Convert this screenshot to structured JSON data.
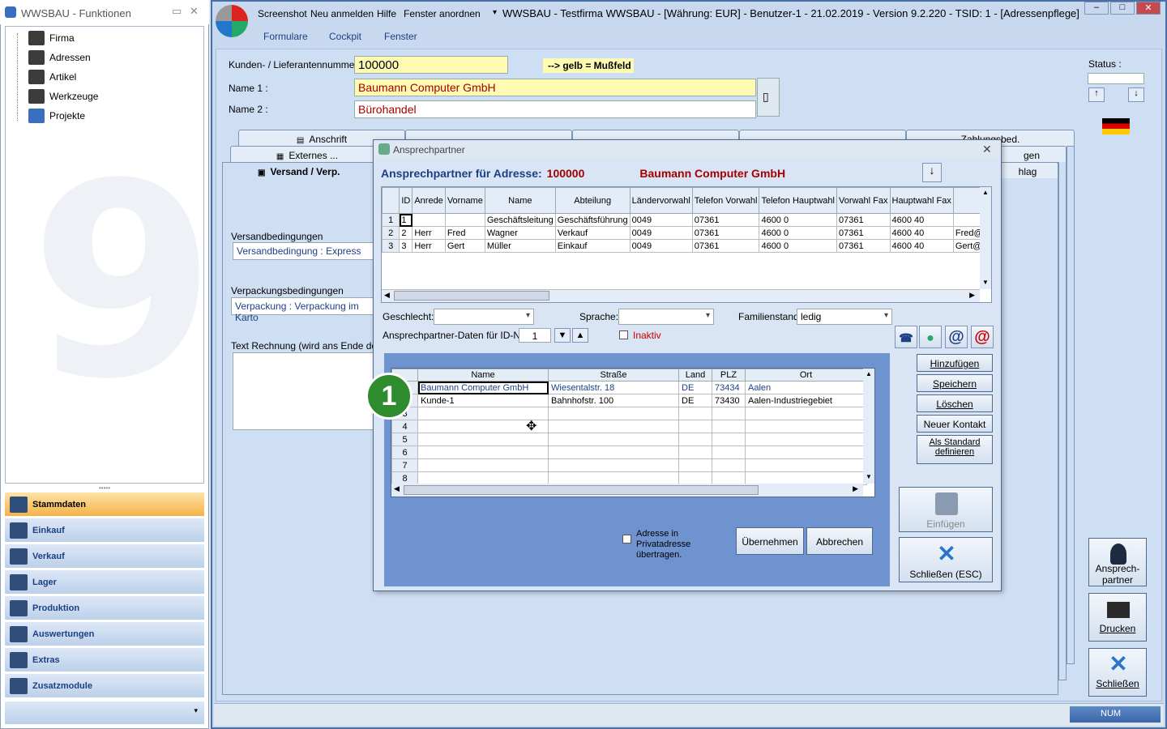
{
  "left_panel": {
    "title": "WWSBAU - Funktionen",
    "tree": [
      "Firma",
      "Adressen",
      "Artikel",
      "Werkzeuge",
      "Projekte"
    ],
    "nav": [
      "Stammdaten",
      "Einkauf",
      "Verkauf",
      "Lager",
      "Produktion",
      "Auswertungen",
      "Extras",
      "Zusatzmodule"
    ],
    "active_nav": "Stammdaten"
  },
  "titlebar": {
    "menus": [
      "Screenshot",
      "Neu anmelden",
      "Hilfe",
      "Fenster anordnen"
    ],
    "title": "WWSBAU - Testfirma WWSBAU - [Währung: EUR] - Benutzer-1 - 21.02.2019 - Version 9.2.220 - TSID: 1 - [Adressenpflege]"
  },
  "menubar": [
    "Formulare",
    "Cockpit",
    "Fenster"
  ],
  "header": {
    "kundennr_label": "Kunden- / Lieferantennummer :",
    "kundennr": "100000",
    "mussfeld": "--> gelb = Mußfeld",
    "name1_label": "Name 1 :",
    "name1": "Baumann Computer GmbH",
    "name2_label": "Name 2 :",
    "name2": "Bürohandel"
  },
  "tabs": {
    "row1": [
      "Anschrift",
      "",
      "",
      "",
      "Zahlungsbed."
    ],
    "row2": [
      "Externes ...",
      "gen"
    ],
    "row3": [
      "Versand / Verp.",
      "hlag"
    ]
  },
  "back_form": {
    "versand_label": "Versandbedingungen",
    "versand_value": "Versandbedingung : Express",
    "verpackung_label": "Verpackungsbedingungen",
    "verpackung_value": "Verpackung :  Verpackung im Karto",
    "text_label": "Text Rechnung (wird ans Ende des F"
  },
  "right_side": {
    "status_label": "Status :",
    "btn_ansprech": "Ansprech-partner",
    "btn_drucken": "Drucken",
    "btn_schliessen": "Schließen"
  },
  "statusbar": {
    "num": "NUM"
  },
  "dialog": {
    "title": "Ansprechpartner",
    "head_label": "Ansprechpartner für Adresse:",
    "head_number": "100000",
    "head_company": "Baumann Computer GmbH",
    "grid1": {
      "columns": [
        "ID",
        "Anrede",
        "Vorname",
        "Name",
        "Abteilung",
        "Ländervorwahl",
        "Telefon Vorwahl",
        "Telefon Hauptwahl",
        "Vorwahl Fax",
        "Hauptwahl Fax",
        ""
      ],
      "rows": [
        {
          "rh": "1",
          "cells": [
            "1",
            "",
            "",
            "Geschäftsleitung",
            "Geschäftsführung",
            "0049",
            "07361",
            "4600 0",
            "07361",
            "4600 40",
            ""
          ]
        },
        {
          "rh": "2",
          "cells": [
            "2",
            "Herr",
            "Fred",
            "Wagner",
            "Verkauf",
            "0049",
            "07361",
            "4600 0",
            "07361",
            "4600 40",
            "Fred@E"
          ]
        },
        {
          "rh": "3",
          "cells": [
            "3",
            "Herr",
            "Gert",
            "Müller",
            "Einkauf",
            "0049",
            "07361",
            "4600 0",
            "07361",
            "4600 40",
            "Gert@B"
          ]
        }
      ]
    },
    "geschlecht_label": "Geschlecht:",
    "geschlecht_value": "",
    "sprache_label": "Sprache:",
    "sprache_value": "",
    "familienstand_label": "Familienstand:",
    "familienstand_value": "ledig",
    "idnr_label": "Ansprechpartner-Daten für ID-Nr.:",
    "idnr_value": "1",
    "inaktiv_label": "Inaktiv",
    "grid2": {
      "columns": [
        "",
        "Name",
        "Straße",
        "Land",
        "PLZ",
        "Ort"
      ],
      "rows": [
        {
          "rh": "",
          "cells": [
            "Baumann Computer GmbH",
            "Wiesentalstr. 18",
            "DE",
            "73434",
            "Aalen"
          ]
        },
        {
          "rh": "",
          "cells": [
            "Kunde-1",
            "Bahnhofstr. 100",
            "DE",
            "73430",
            "Aalen-Industriegebiet"
          ]
        },
        {
          "rh": "3",
          "cells": [
            "",
            "",
            "",
            "",
            ""
          ]
        },
        {
          "rh": "4",
          "cells": [
            "",
            "",
            "",
            "",
            ""
          ]
        },
        {
          "rh": "5",
          "cells": [
            "",
            "",
            "",
            "",
            ""
          ]
        },
        {
          "rh": "6",
          "cells": [
            "",
            "",
            "",
            "",
            ""
          ]
        },
        {
          "rh": "7",
          "cells": [
            "",
            "",
            "",
            "",
            ""
          ]
        },
        {
          "rh": "8",
          "cells": [
            "",
            "",
            "",
            "",
            ""
          ]
        }
      ]
    },
    "badge": "1",
    "privat_label": "Adresse in Privatadresse übertragen.",
    "btn_uebernehmen": "Übernehmen",
    "btn_abbrechen": "Abbrechen",
    "btn_hinzufuegen": "Hinzufügen",
    "btn_speichern": "Speichern",
    "btn_loeschen": "Löschen",
    "btn_neuer_kontakt": "Neuer Kontakt",
    "btn_als_standard": "Als Standard definieren",
    "btn_einfuegen": "Einfügen",
    "btn_schliessen_esc": "Schließen (ESC)"
  }
}
